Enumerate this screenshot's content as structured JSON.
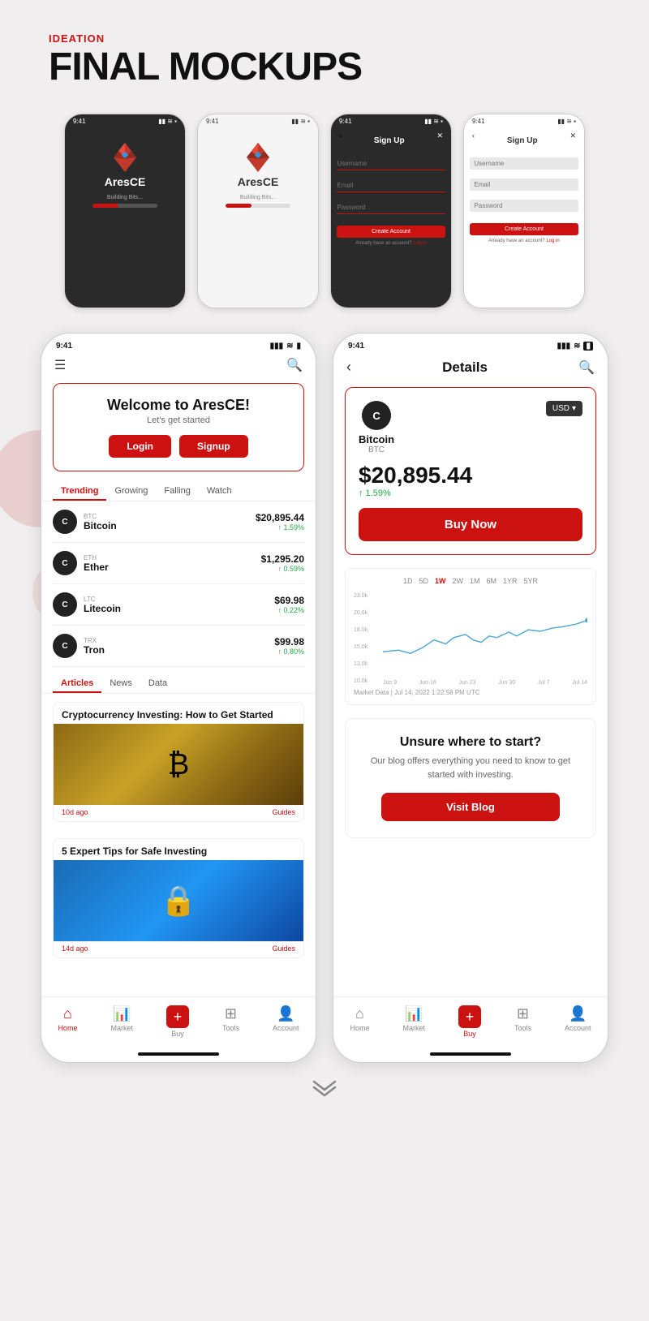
{
  "header": {
    "ideation": "IDEATION",
    "title": "FINAL MOCKUPS"
  },
  "phones_top": [
    {
      "id": "splash-dark",
      "theme": "dark",
      "time": "9:41",
      "logo_name": "AresCE",
      "building_text": "Building Bits...",
      "type": "splash"
    },
    {
      "id": "splash-light",
      "theme": "light",
      "time": "9:41",
      "logo_name": "AresCE",
      "building_text": "Building Bits...",
      "type": "splash"
    },
    {
      "id": "signup-dark",
      "theme": "dark",
      "time": "9:41",
      "title": "Sign Up",
      "fields": [
        "Username",
        "Email",
        "Password"
      ],
      "btn": "Create Account",
      "already": "Already have an account?",
      "login_link": "Log in",
      "type": "signup"
    },
    {
      "id": "signup-light",
      "theme": "light",
      "time": "9:41",
      "title": "Sign Up",
      "fields": [
        "Username",
        "Email",
        "Password"
      ],
      "btn": "Create Account",
      "already": "Already have an account?",
      "login_link": "Log in",
      "type": "signup"
    }
  ],
  "home_phone": {
    "time": "9:41",
    "welcome": {
      "title": "Welcome to AresCE!",
      "subtitle": "Let's get started",
      "login_btn": "Login",
      "signup_btn": "Signup"
    },
    "tabs": [
      "Trending",
      "Growing",
      "Falling",
      "Watch"
    ],
    "active_tab": "Trending",
    "cryptos": [
      {
        "ticker": "BTC",
        "name": "Bitcoin",
        "price": "$20,895.44",
        "change": "↑ 1.59%"
      },
      {
        "ticker": "ETH",
        "name": "Ether",
        "price": "$1,295.20",
        "change": "↑ 0.59%"
      },
      {
        "ticker": "LTC",
        "name": "Litecoin",
        "price": "$69.98",
        "change": "↑ 0.22%"
      },
      {
        "ticker": "TRX",
        "name": "Tron",
        "price": "$99.98",
        "change": "↑ 0.80%"
      }
    ],
    "article_tabs": [
      "Articles",
      "News",
      "Data"
    ],
    "active_article_tab": "Articles",
    "articles": [
      {
        "title": "Cryptocurrency Investing: How to Get Started",
        "age": "10d ago",
        "category": "Guides",
        "type": "bitcoin"
      },
      {
        "title": "5 Expert Tips for Safe Investing",
        "age": "14d ago",
        "category": "Guides",
        "type": "lock"
      }
    ],
    "nav_items": [
      "Home",
      "Market",
      "Buy",
      "Tools",
      "Account"
    ],
    "active_nav": "Home"
  },
  "details_phone": {
    "time": "9:41",
    "page_title": "Details",
    "bitcoin": {
      "name": "Bitcoin",
      "ticker": "BTC",
      "price": "$20,895.44",
      "change": "↑ 1.59%",
      "currency": "USD",
      "buy_btn": "Buy Now"
    },
    "chart": {
      "time_tabs": [
        "1D",
        "5D",
        "1W",
        "2W",
        "1M",
        "6M",
        "1YR",
        "5YR"
      ],
      "active_tab": "1W",
      "y_labels": [
        "23.0k",
        "20.0k",
        "18.0k",
        "15.0k",
        "13.0k",
        "10.0k"
      ],
      "x_labels": [
        "Jun 9",
        "Jun 16",
        "Jun 23",
        "Jun 30",
        "Jul 7",
        "Jul 14"
      ],
      "market_data": "Market Data | Jul 14, 2022 1:22:58 PM UTC"
    },
    "blog": {
      "title": "Unsure where to start?",
      "subtitle": "Our blog offers everything you need to know to get started with investing.",
      "btn": "Visit Blog"
    },
    "nav_items": [
      "Home",
      "Market",
      "Buy",
      "Tools",
      "Account"
    ],
    "active_nav": "Buy"
  },
  "chevron": "⌄⌄"
}
